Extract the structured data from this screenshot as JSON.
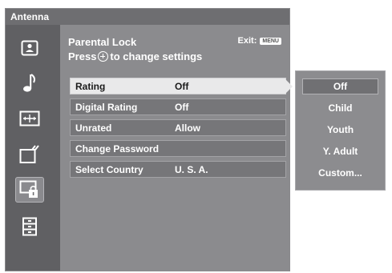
{
  "window": {
    "title": "Antenna"
  },
  "sidebar": {
    "icons": [
      {
        "name": "picture-icon"
      },
      {
        "name": "sound-icon"
      },
      {
        "name": "screen-icon"
      },
      {
        "name": "channel-setup-icon"
      },
      {
        "name": "parental-lock-icon",
        "selected": true
      },
      {
        "name": "setup-icon"
      }
    ]
  },
  "panel": {
    "title": "Parental Lock",
    "hint_prefix": "Press",
    "hint_suffix": "to change settings",
    "exit_label": "Exit:",
    "exit_key": "MENU"
  },
  "settings": [
    {
      "label": "Rating",
      "value": "Off",
      "active": true
    },
    {
      "label": "Digital Rating",
      "value": "Off"
    },
    {
      "label": "Unrated",
      "value": "Allow"
    },
    {
      "label": "Change Password",
      "value": ""
    },
    {
      "label": "Select Country",
      "value": "U. S. A."
    }
  ],
  "options": [
    {
      "label": "Off",
      "selected": true
    },
    {
      "label": "Child"
    },
    {
      "label": "Youth"
    },
    {
      "label": "Y. Adult"
    },
    {
      "label": "Custom..."
    }
  ]
}
